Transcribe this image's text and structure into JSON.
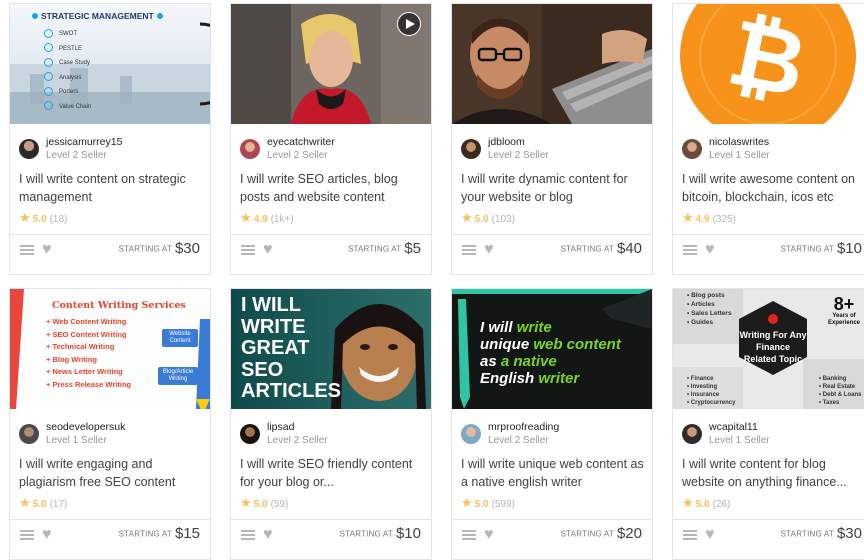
{
  "gigs": [
    {
      "seller_name": "jessicamurrey15",
      "seller_level": "Level 2 Seller",
      "title": "I will write content on strategic management",
      "rating": "5.0",
      "rating_count": "(18)",
      "starting_label": "STARTING AT",
      "price": "$30",
      "thumb": {
        "heading": "STRATEGIC MANAGEMENT",
        "items": [
          "SWOT",
          "PESTLE",
          "Case Study",
          "Analysis",
          "Porters",
          "Value Chain"
        ]
      }
    },
    {
      "seller_name": "eyecatchwriter",
      "seller_level": "Level 2 Seller",
      "title": "I will write SEO articles, blog posts and website content",
      "rating": "4.9",
      "rating_count": "(1k+)",
      "starting_label": "STARTING AT",
      "price": "$5"
    },
    {
      "seller_name": "jdbloom",
      "seller_level": "Level 2 Seller",
      "title": "I will write dynamic content for your website or blog",
      "rating": "5.0",
      "rating_count": "(103)",
      "starting_label": "STARTING AT",
      "price": "$40"
    },
    {
      "seller_name": "nicolaswrites",
      "seller_level": "Level 1 Seller",
      "title": "I will write awesome content on bitcoin, blockchain, icos etc",
      "rating": "4.9",
      "rating_count": "(325)",
      "starting_label": "STARTING AT",
      "price": "$10"
    },
    {
      "seller_name": "seodevelopersuk",
      "seller_level": "Level 1 Seller",
      "title": "I will write engaging and plagiarism free SEO content",
      "rating": "5.0",
      "rating_count": "(17)",
      "starting_label": "STARTING AT",
      "price": "$15",
      "thumb": {
        "heading": "Content Writing Services",
        "items": [
          "Web Content Writing",
          "SEO Content Writing",
          "Technical Writing",
          "Blog Writing",
          "News Letter Writing",
          "Press Release Writing"
        ],
        "badge1": "Website Content",
        "badge2": "Blog/Article Writing"
      }
    },
    {
      "seller_name": "lipsad",
      "seller_level": "Level 2 Seller",
      "title": "I will write SEO friendly content for your blog or...",
      "rating": "5.0",
      "rating_count": "(59)",
      "starting_label": "STARTING AT",
      "price": "$10",
      "thumb": {
        "lines": [
          "I WILL",
          "WRITE",
          "GREAT",
          "SEO",
          "ARTICLES"
        ]
      }
    },
    {
      "seller_name": "mrproofreading",
      "seller_level": "Level 2 Seller",
      "title": "I will write unique web content as a native english writer",
      "rating": "5.0",
      "rating_count": "(599)",
      "starting_label": "STARTING AT",
      "price": "$20",
      "thumb": {
        "line1a": "I will ",
        "line1b": "write",
        "line2a": "unique ",
        "line2b": "web content",
        "line3a": "as ",
        "line3b": "a native",
        "line4a": "English ",
        "line4b": "writer"
      }
    },
    {
      "seller_name": "wcapital11",
      "seller_level": "Level 1 Seller",
      "title": "I will write content for blog website on anything finance...",
      "rating": "5.0",
      "rating_count": "(26)",
      "starting_label": "STARTING AT",
      "price": "$30",
      "thumb": {
        "left_items": [
          "Blog posts",
          "Articles",
          "Sales Letters",
          "Guides"
        ],
        "bottom_left_items": [
          "Finance",
          "Investing",
          "Insurance",
          "Cryptocurrency"
        ],
        "bottom_right_items": [
          "Banking",
          "Real Estate",
          "Debt & Loans",
          "Taxes"
        ],
        "hex_text": "Writing For Any Finance Related Topic",
        "badge_number": "8+",
        "badge_text": "Years of Experience"
      }
    }
  ],
  "colors": {
    "star": "#ffbe5b",
    "bitcoin": "#f7931a",
    "lime": "#7ed321"
  }
}
